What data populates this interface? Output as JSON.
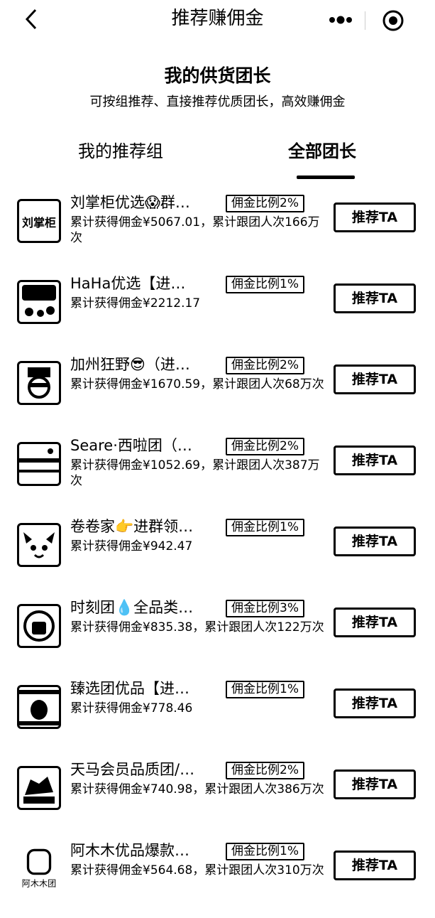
{
  "nav": {
    "title": "推荐赚佣金"
  },
  "header": {
    "title": "我的供货团长",
    "subtitle": "可按组推荐、直接推荐优质团长，高效赚佣金"
  },
  "tabs": [
    "我的推荐组",
    "全部团长"
  ],
  "active_tab": "全部团长",
  "recommend_label": "推荐TA",
  "avatars": [
    "刘掌柜",
    "阿木木团"
  ],
  "leaders": [
    {
      "name": "刘掌柜优选😱群…",
      "badge": "佣金比例2%",
      "stats": "累计获得佣金¥5067.01，累计跟团人次166万次"
    },
    {
      "name": "HaHa优选【进…",
      "badge": "佣金比例1%",
      "stats": "累计获得佣金¥2212.17"
    },
    {
      "name": "加州狂野😎（进…",
      "badge": "佣金比例2%",
      "stats": "累计获得佣金¥1670.59，累计跟团人次68万次"
    },
    {
      "name": "Seare·西啦团（…",
      "badge": "佣金比例2%",
      "stats": "累计获得佣金¥1052.69，累计跟团人次387万次"
    },
    {
      "name": "卷卷家👉进群领…",
      "badge": "佣金比例1%",
      "stats": "累计获得佣金¥942.47"
    },
    {
      "name": "时刻团💧全品类…",
      "badge": "佣金比例3%",
      "stats": "累计获得佣金¥835.38，累计跟团人次122万次"
    },
    {
      "name": "臻选团优品【进…",
      "badge": "佣金比例1%",
      "stats": "累计获得佣金¥778.46"
    },
    {
      "name": "天马会员品质团/…",
      "badge": "佣金比例2%",
      "stats": "累计获得佣金¥740.98，累计跟团人次386万次"
    },
    {
      "name": "阿木木优品爆款…",
      "badge": "佣金比例1%",
      "stats": "累计获得佣金¥564.68，累计跟团人次310万次"
    }
  ]
}
